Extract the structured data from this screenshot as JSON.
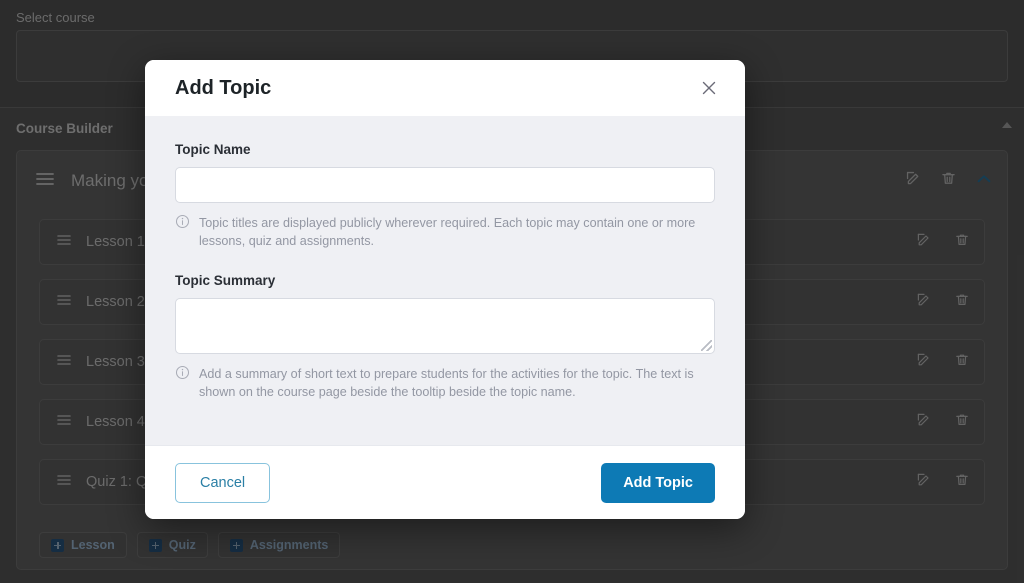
{
  "background": {
    "select_course_label": "Select course",
    "course_builder_label": "Course Builder",
    "topic": {
      "title": "Making your",
      "drag_icon": "hamburger-drag-icon",
      "edit_icon": "edit-pencil-icon",
      "delete_icon": "trash-icon",
      "collapse_icon": "chevron-up-icon"
    },
    "rows": [
      {
        "title": "Lesson 1:"
      },
      {
        "title": "Lesson 2:"
      },
      {
        "title": "Lesson 3:"
      },
      {
        "title": "Lesson 4:"
      },
      {
        "title": "Quiz 1: Qu"
      }
    ],
    "add_buttons": [
      {
        "label": "Lesson"
      },
      {
        "label": "Quiz"
      },
      {
        "label": "Assignments"
      }
    ],
    "scroll_arrow_icon": "scroll-up-arrow-icon"
  },
  "modal": {
    "title": "Add Topic",
    "close_icon": "close-x-icon",
    "fields": {
      "topic_name": {
        "label": "Topic Name",
        "value": "",
        "placeholder": "",
        "help": "Topic titles are displayed publicly wherever required. Each topic may contain one or more lessons, quiz and assignments.",
        "help_icon": "info-circle-icon"
      },
      "topic_summary": {
        "label": "Topic Summary",
        "value": "",
        "placeholder": "",
        "help": "Add a summary of short text to prepare students for the activities for the topic. The text is shown on the course page beside the tooltip beside the topic name.",
        "help_icon": "info-circle-icon",
        "resize_handle_icon": "resize-grip-icon"
      }
    },
    "footer": {
      "cancel_label": "Cancel",
      "submit_label": "Add Topic"
    }
  },
  "colors": {
    "primary": "#0d7ab5",
    "cancel_border": "#88c3dd",
    "modal_body": "#eff0f4",
    "backdrop": "#3c3c3c"
  }
}
